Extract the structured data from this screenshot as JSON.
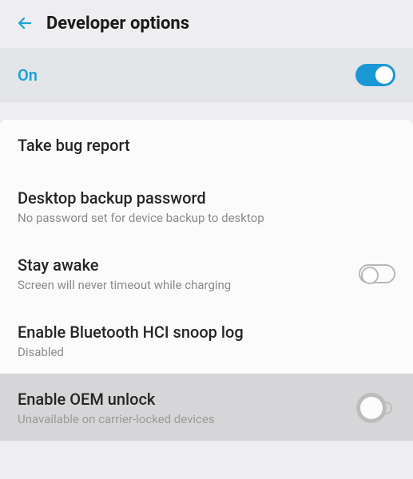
{
  "header": {
    "title": "Developer options"
  },
  "master": {
    "label": "On",
    "state": "on"
  },
  "items": [
    {
      "title": "Take bug report",
      "sub": ""
    },
    {
      "title": "Desktop backup password",
      "sub": "No password set for device backup to desktop"
    },
    {
      "title": "Stay awake",
      "sub": "Screen will never timeout while charging",
      "toggle": "off"
    },
    {
      "title": "Enable Bluetooth HCI snoop log",
      "sub": "Disabled"
    },
    {
      "title": "Enable OEM unlock",
      "sub": "Unavailable on carrier-locked devices",
      "toggle": "disabled",
      "selected": true
    }
  ]
}
